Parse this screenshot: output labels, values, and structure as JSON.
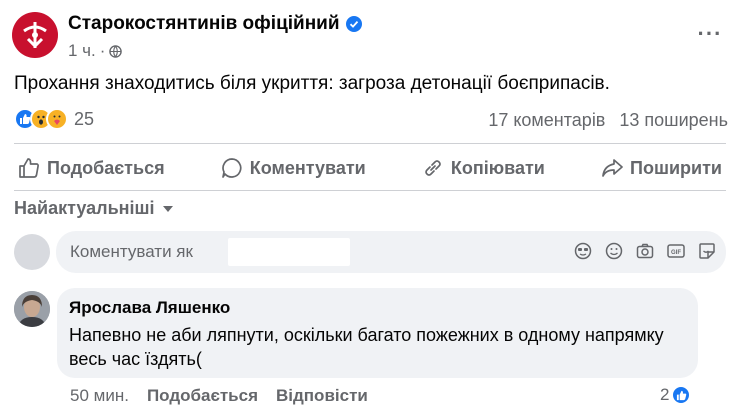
{
  "post": {
    "page_name": "Старокостянтинів офіційний",
    "time": "1 ч.",
    "separator": "·",
    "text": "Прохання знаходитись біля укриття: загроза детонації боєприпасів.",
    "reactions_count": "25",
    "comments_count": "17 коментарів",
    "shares_count": "13 поширень"
  },
  "actions": {
    "like": "Подобається",
    "comment": "Коментувати",
    "copy": "Копіювати",
    "share": "Поширити"
  },
  "sort": {
    "label": "Найактуальніші"
  },
  "composer": {
    "placeholder": "Коментувати як"
  },
  "comment": {
    "author": "Ярослава Ляшенко",
    "text": "Напевно не аби ляпнути, оскільки багато пожежних в одному напрямку весь час їздять(",
    "time": "50 мин.",
    "like": "Подобається",
    "reply": "Відповісти",
    "likes_count": "2"
  },
  "colors": {
    "brand_red": "#c8102e",
    "facebook_blue": "#1877f2",
    "secondary_text": "#65676b",
    "bubble_bg": "#f0f2f5"
  }
}
